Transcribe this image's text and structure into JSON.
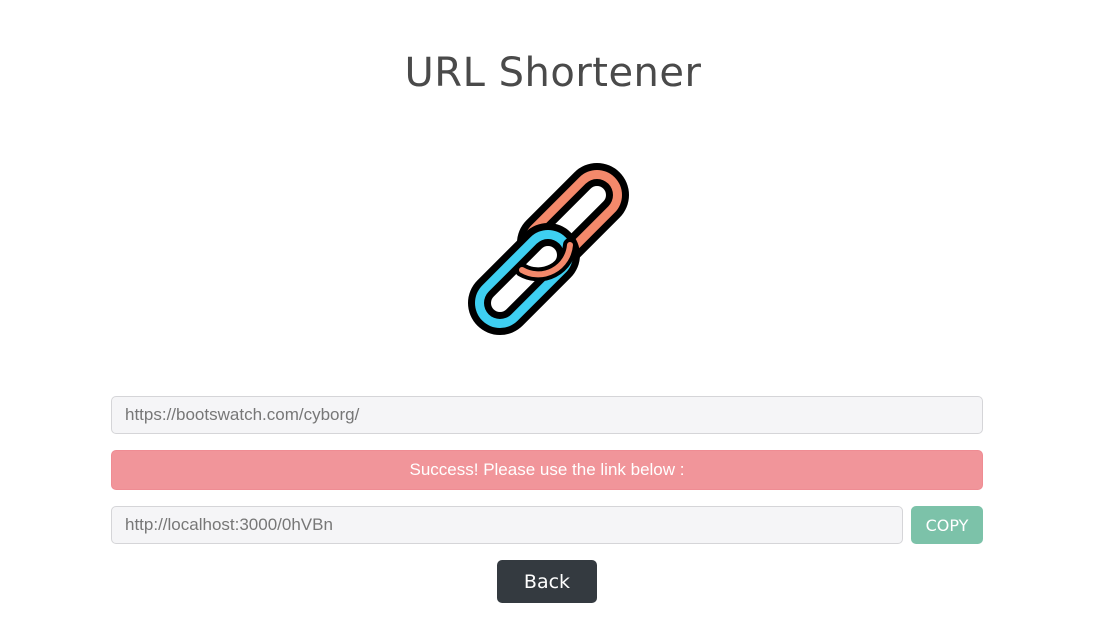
{
  "app": {
    "title": "URL Shortener"
  },
  "logo": {
    "icon": "chain-link-icon",
    "colors": {
      "left_link": "#3ecff1",
      "right_link": "#f4896b",
      "outline": "#000000"
    }
  },
  "form": {
    "url_input_value": "https://bootswatch.com/cyborg/"
  },
  "alert": {
    "message": "Success! Please use the link below :",
    "color": "#f1959a"
  },
  "result": {
    "short_url_value": "http://localhost:3000/0hVBn",
    "copy_label": "COPY",
    "copy_color": "#7cc2a9"
  },
  "actions": {
    "back_label": "Back",
    "back_color": "#343a40"
  }
}
